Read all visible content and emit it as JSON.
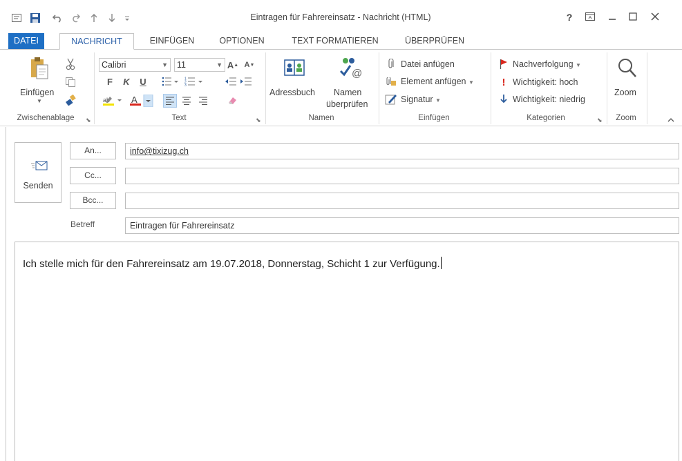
{
  "window": {
    "title": "Eintragen für Fahrereinsatz - Nachricht (HTML)",
    "help": "?",
    "controls": [
      "restore-ribbon",
      "minimize",
      "maximize",
      "close"
    ]
  },
  "quick_access": {
    "icons": [
      "outlook-app-icon",
      "save-icon",
      "undo-icon",
      "redo-icon",
      "up-arrow-icon",
      "down-arrow-icon",
      "customize-icon"
    ]
  },
  "tabs": [
    {
      "label": "DATEI"
    },
    {
      "label": "NACHRICHT"
    },
    {
      "label": "EINFÜGEN"
    },
    {
      "label": "OPTIONEN"
    },
    {
      "label": "TEXT FORMATIEREN"
    },
    {
      "label": "ÜBERPRÜFEN"
    }
  ],
  "ribbon": {
    "clipboard": {
      "paste_label": "Einfügen",
      "group_label": "Zwischenablage"
    },
    "text": {
      "font": "Calibri",
      "size": "11",
      "bold": "F",
      "italic": "K",
      "underline": "U",
      "group_label": "Text"
    },
    "names": {
      "addressbook": "Adressbuch",
      "check_names_1": "Namen",
      "check_names_2": "überprüfen",
      "group_label": "Namen"
    },
    "include": {
      "attach_file": "Datei anfügen",
      "attach_item": "Element anfügen",
      "signature": "Signatur",
      "group_label": "Einfügen"
    },
    "tags": {
      "followup": "Nachverfolgung",
      "high": "Wichtigkeit: hoch",
      "low": "Wichtigkeit: niedrig",
      "group_label": "Kategorien"
    },
    "zoom": {
      "button_label": "Zoom",
      "group_label": "Zoom"
    }
  },
  "compose": {
    "send_label": "Senden",
    "to_label": "An...",
    "cc_label": "Cc...",
    "bcc_label": "Bcc...",
    "subject_label": "Betreff",
    "to_value": "info@tixizug.ch",
    "cc_value": "",
    "bcc_value": "",
    "subject_value": "Eintragen für Fahrereinsatz",
    "body": "Ich stelle mich für den Fahrereinsatz am 19.07.2018, Donnerstag, Schicht 1 zur Verfügung."
  },
  "colors": {
    "accent": "#1e6fc4",
    "active_tab_text": "#2a5fa8",
    "highlight_color": "#f4e300",
    "font_color": "#d9261c",
    "flag_color": "#d9261c"
  }
}
